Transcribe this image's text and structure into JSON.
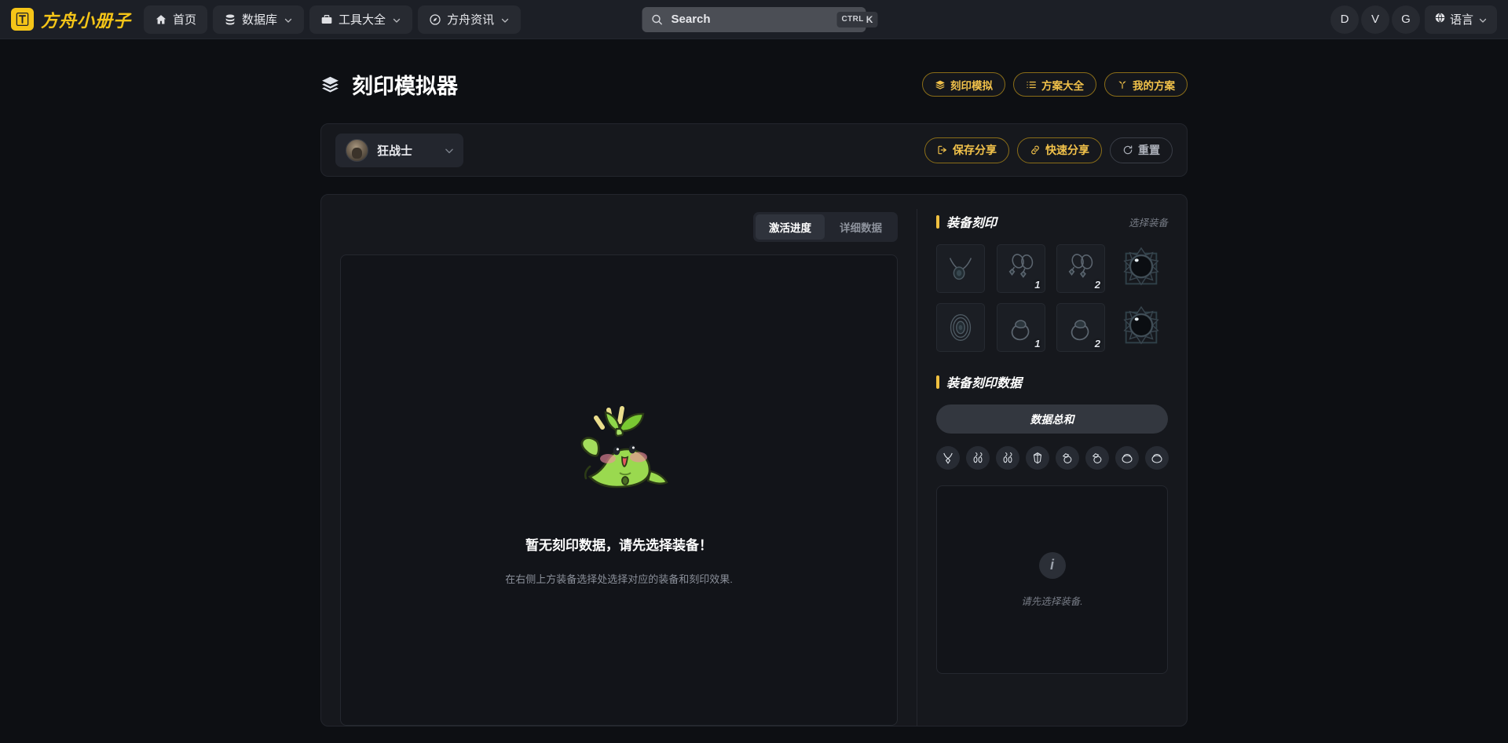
{
  "navbar": {
    "brand": {
      "name": "方舟小册子",
      "logo_icon": "ark-logo-icon",
      "accent": "#f5c518"
    },
    "items": [
      {
        "label": "首页",
        "icon": "home-icon",
        "has_caret": false
      },
      {
        "label": "数据库",
        "icon": "database-icon",
        "has_caret": true
      },
      {
        "label": "工具大全",
        "icon": "toolbox-icon",
        "has_caret": true
      },
      {
        "label": "方舟资讯",
        "icon": "compass-icon",
        "has_caret": true
      }
    ],
    "search": {
      "placeholder": "Search",
      "value": "",
      "icon": "search-icon",
      "shortcut_mod": "CTRL",
      "shortcut_key": "K"
    },
    "right_buttons": [
      {
        "label": "D",
        "name": "discord-button"
      },
      {
        "label": "V",
        "name": "v-button"
      },
      {
        "label": "G",
        "name": "g-button"
      }
    ],
    "language": {
      "label": "语言",
      "icon": "globe-icon"
    }
  },
  "page": {
    "title": "刻印模拟器",
    "title_icon": "layers-icon",
    "head_actions": [
      {
        "label": "刻印模拟",
        "icon": "layers-icon",
        "active": true
      },
      {
        "label": "方案大全",
        "icon": "list-icon",
        "active": false
      },
      {
        "label": "我的方案",
        "icon": "sprout-icon",
        "active": false
      }
    ]
  },
  "class_bar": {
    "selected_class": "狂战士",
    "avatar": "berserker-avatar",
    "caret_icon": "chevron-down-icon",
    "actions": [
      {
        "label": "保存分享",
        "icon": "share-save-icon",
        "style": "outline-gold"
      },
      {
        "label": "快速分享",
        "icon": "link-icon",
        "style": "outline-gold"
      },
      {
        "label": "重置",
        "icon": "refresh-icon",
        "style": "outline-gray"
      }
    ]
  },
  "left_panel": {
    "tabs": [
      {
        "label": "激活进度",
        "active": true
      },
      {
        "label": "详细数据",
        "active": false
      }
    ],
    "empty_state": {
      "illustration": "green-mascot-icon",
      "title": "暂无刻印数据，请先选择装备！",
      "subtitle": "在右侧上方装备选择处选择对应的装备和刻印效果."
    }
  },
  "right_panel": {
    "engraving_section": {
      "title": "装备刻印",
      "action": "选择装备",
      "slots": [
        {
          "name": "necklace-slot",
          "icon": "necklace-icon",
          "index": ""
        },
        {
          "name": "earring-slot-1",
          "icon": "earring-icon",
          "index": "1"
        },
        {
          "name": "earring-slot-2",
          "icon": "earring-icon",
          "index": "2"
        },
        {
          "name": "orb-slot-1",
          "icon": "orb-icon",
          "index": ""
        },
        {
          "name": "ability-stone-slot",
          "icon": "ability-stone-icon",
          "index": ""
        },
        {
          "name": "ring-slot-1",
          "icon": "ring-icon",
          "index": "1"
        },
        {
          "name": "ring-slot-2",
          "icon": "ring-icon",
          "index": "2"
        },
        {
          "name": "orb-slot-2",
          "icon": "orb-icon",
          "index": ""
        }
      ]
    },
    "data_section": {
      "title": "装备刻印数据",
      "total_button": "数据总和",
      "icons": [
        "necklace-icon",
        "earring-pair-icon",
        "earring-pair-alt-icon",
        "ability-stone-icon",
        "ring-icon",
        "ring-alt-icon",
        "bracelet-icon",
        "bracelet-alt-icon"
      ],
      "info": {
        "icon": "info-icon",
        "text": "请先选择装备."
      }
    }
  },
  "colors": {
    "accent_gold": "#f0c040",
    "page_bg": "#0d0f13",
    "panel_bg": "#16181d",
    "nav_bg": "#1c1f26"
  }
}
